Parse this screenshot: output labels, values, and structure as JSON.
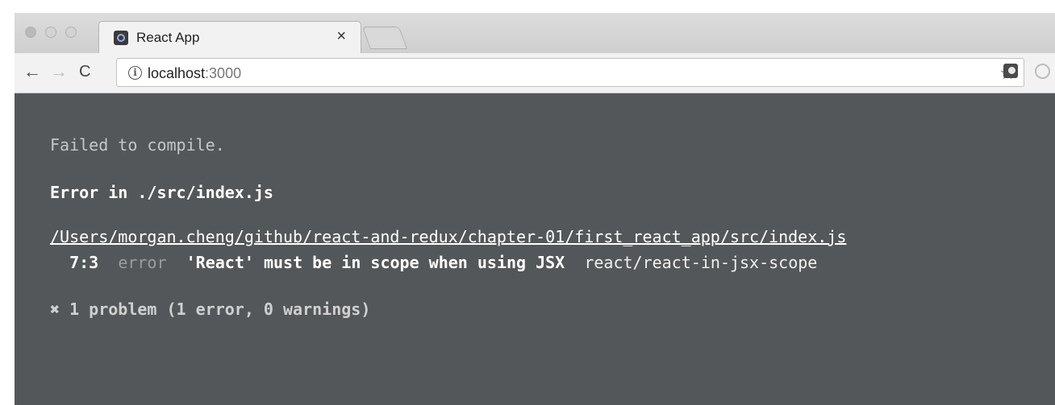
{
  "browser": {
    "tab": {
      "title": "React App",
      "close": "×"
    },
    "toolbar": {
      "back": "←",
      "forward": "→",
      "reload": "C",
      "info": "i",
      "url_host": "localhost",
      "url_port": ":3000",
      "star": "☆"
    }
  },
  "overlay": {
    "heading": "Failed to compile.",
    "error_title": "Error in ./src/index.js",
    "file_path": "/Users/morgan.cheng/github/react-and-redux/chapter-01/first_react_app/src/index.js",
    "lint": {
      "position": "7:3",
      "severity": "error",
      "message": "'React' must be in scope when using JSX",
      "rule": "react/react-in-jsx-scope"
    },
    "summary": "✖ 1 problem (1 error, 0 warnings)"
  },
  "colors": {
    "background": "#545759",
    "text": "#ffffff",
    "muted": "#9a9d9f"
  }
}
